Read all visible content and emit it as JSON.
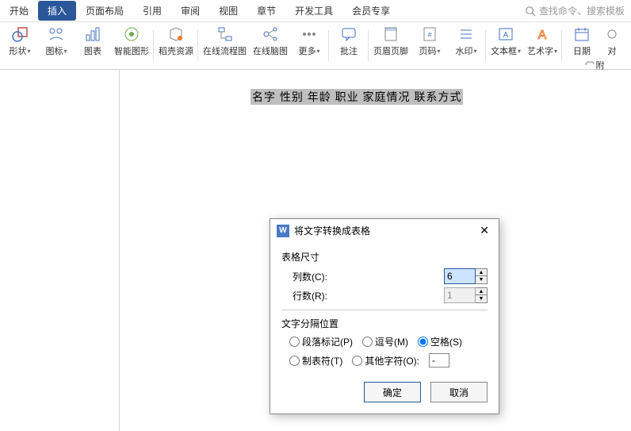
{
  "tabs": {
    "start": "开始",
    "insert": "插入",
    "layout": "页面布局",
    "reference": "引用",
    "review": "审阅",
    "view": "视图",
    "section": "章节",
    "dev": "开发工具",
    "vip": "会员专享"
  },
  "search": {
    "placeholder": "查找命令、搜索模板"
  },
  "ribbon": {
    "shape": "形状",
    "icons": "图标",
    "chart": "图表",
    "smartart": "智能图形",
    "resource": "稻壳资源",
    "flowchart": "在线流程图",
    "mindmap": "在线脑图",
    "more": "更多",
    "comment": "批注",
    "headerfooter": "页眉页脚",
    "pagenum": "页码",
    "watermark": "水印",
    "textbox": "文本框",
    "wordart": "艺术字",
    "date": "日期",
    "object": "对",
    "attach": "附"
  },
  "doc": {
    "selected": "名字 性别 年龄 职业 家庭情况 联系方式"
  },
  "dialog": {
    "title": "将文字转换成表格",
    "size_section": "表格尺寸",
    "cols_label": "列数(C):",
    "cols_value": "6",
    "rows_label": "行数(R):",
    "rows_value": "1",
    "sep_section": "文字分隔位置",
    "para": "段落标记(P)",
    "comma": "逗号(M)",
    "space": "空格(S)",
    "tab": "制表符(T)",
    "other": "其他字符(O):",
    "other_value": "-",
    "ok": "确定",
    "cancel": "取消"
  }
}
